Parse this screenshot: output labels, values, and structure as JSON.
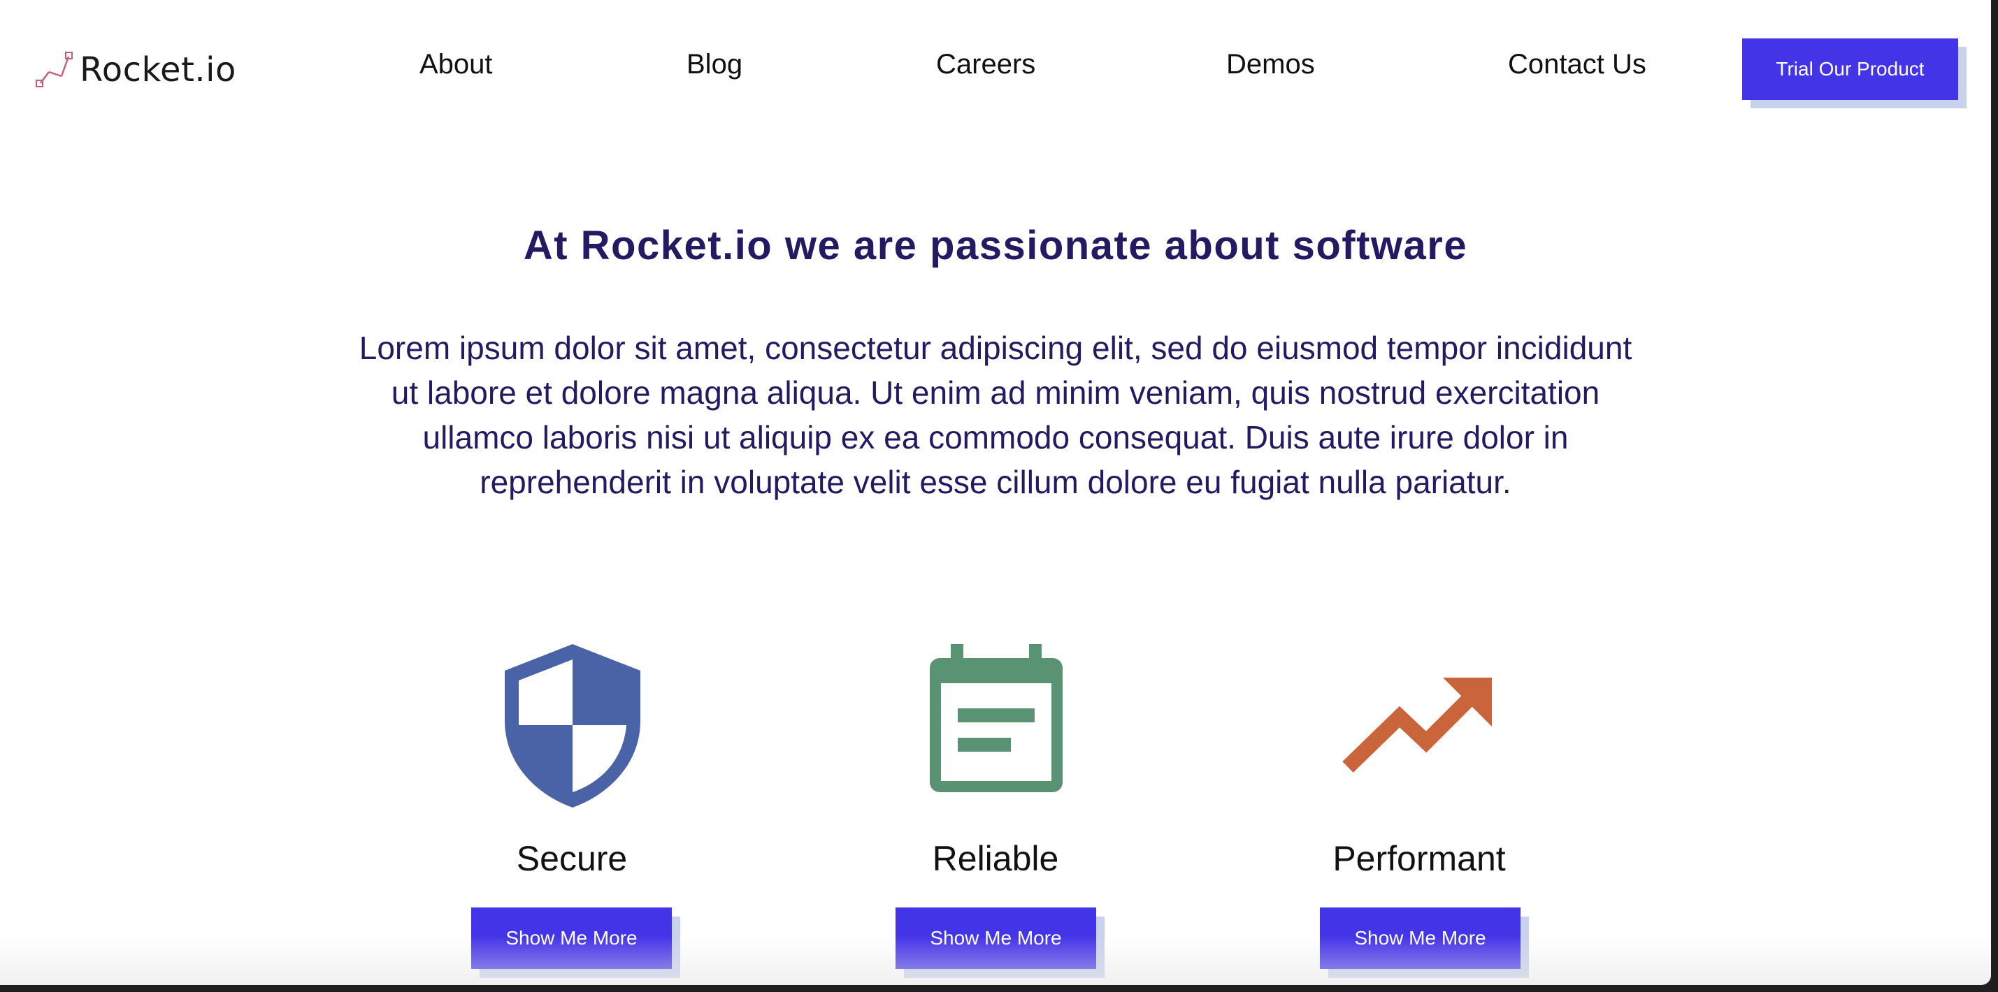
{
  "header": {
    "logo_text": "Rocket.io",
    "nav": [
      "About",
      "Blog",
      "Careers",
      "Demos",
      "Contact Us"
    ],
    "cta_label": "Trial Our Product"
  },
  "hero": {
    "headline": "At Rocket.io we are passionate about software",
    "intro": "Lorem ipsum dolor sit amet, consectetur adipiscing elit, sed do eiusmod tempor incididunt ut labore et dolore magna aliqua. Ut enim ad minim veniam, quis nostrud exercitation ullamco laboris nisi ut aliquip ex ea commodo consequat. Duis aute irure dolor in reprehenderit in voluptate velit esse cillum dolore eu fugiat nulla pariatur."
  },
  "features": [
    {
      "title": "Secure",
      "icon": "shield-icon",
      "button_label": "Show Me More",
      "color": "#4a62a6"
    },
    {
      "title": "Reliable",
      "icon": "calendar-icon",
      "button_label": "Show Me More",
      "color": "#5a9373"
    },
    {
      "title": "Performant",
      "icon": "trending-up-icon",
      "button_label": "Show Me More",
      "color": "#c9643b"
    }
  ],
  "colors": {
    "accent": "#4434e8",
    "button_shadow": "#c9d2ec",
    "heading": "#241a63",
    "logo_mark": "#d46a8a"
  }
}
